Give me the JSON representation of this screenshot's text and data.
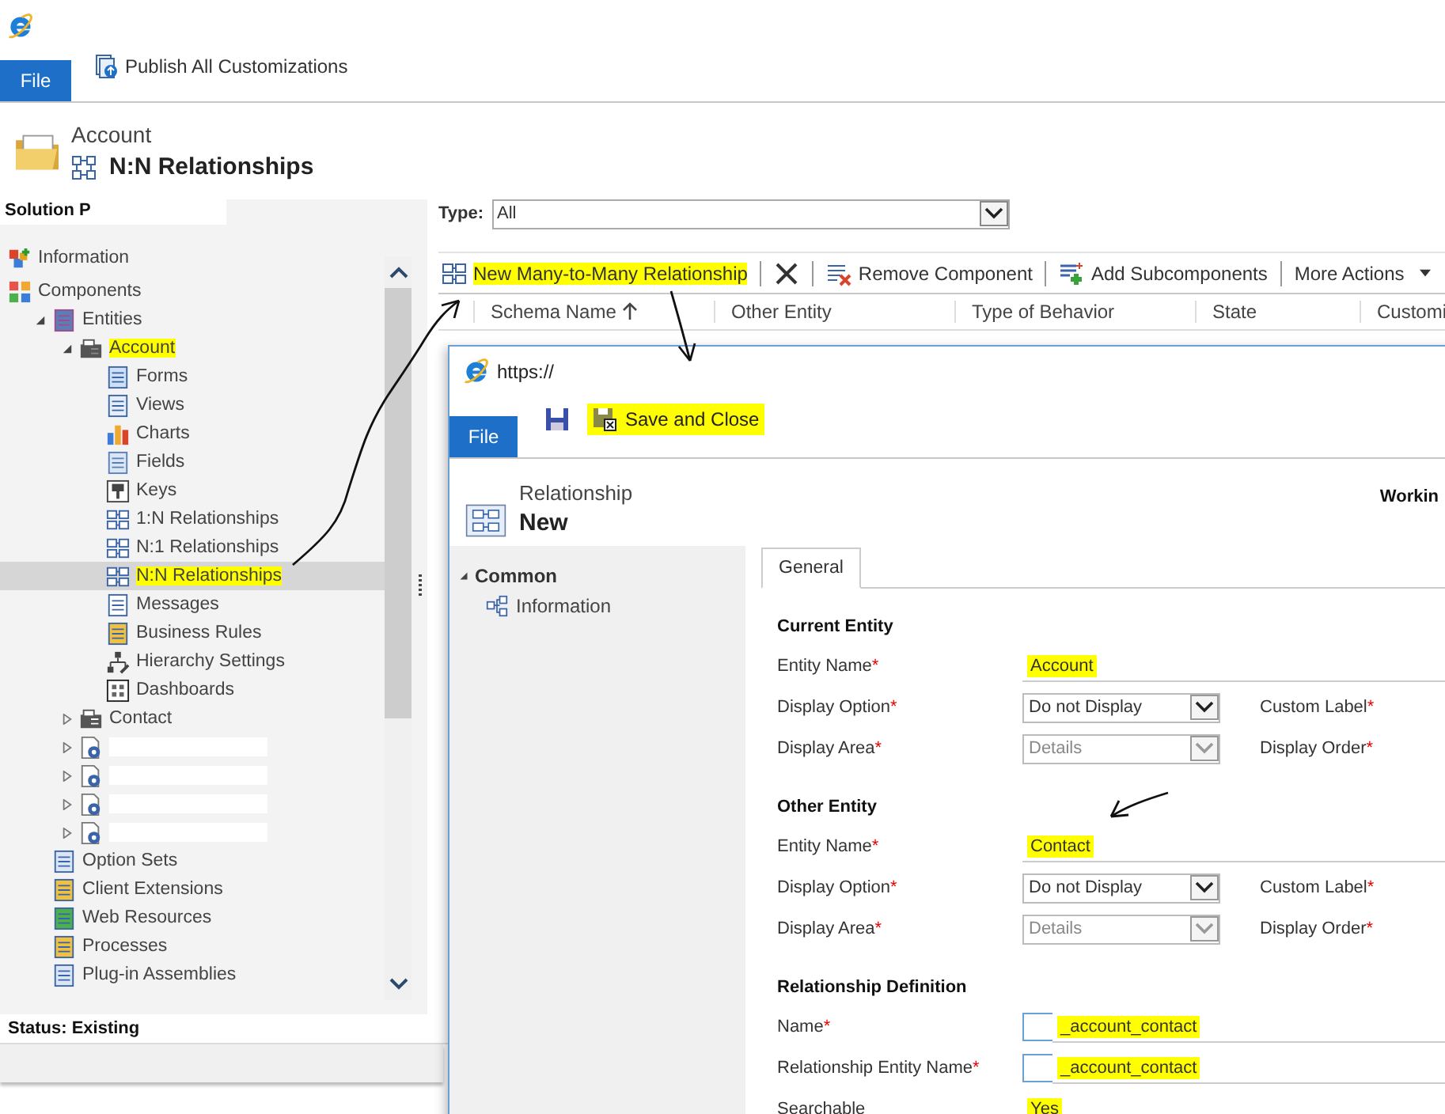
{
  "ribbon": {
    "file_tab": "File",
    "commands": [
      {
        "label": "Publish All Customizations"
      }
    ]
  },
  "header": {
    "entity": "Account",
    "title": "N:N Relationships"
  },
  "solution": {
    "title": "Solution P",
    "status": "Status: Existing",
    "tree": [
      {
        "kind": "info",
        "label": "Information",
        "selected": false,
        "highlighted": false
      },
      {
        "kind": "components",
        "label": "Components",
        "selected": false,
        "highlighted": false,
        "children": [
          {
            "kind": "entities",
            "label": "Entities",
            "selected": false,
            "highlighted": false,
            "expanded": true,
            "children": [
              {
                "kind": "entity",
                "label": "Account",
                "selected": false,
                "highlighted": true,
                "expanded": true,
                "children": [
                  {
                    "kind": "forms",
                    "label": "Forms",
                    "selected": false,
                    "highlighted": false
                  },
                  {
                    "kind": "views",
                    "label": "Views",
                    "selected": false,
                    "highlighted": false
                  },
                  {
                    "kind": "charts",
                    "label": "Charts",
                    "selected": false,
                    "highlighted": false
                  },
                  {
                    "kind": "fields",
                    "label": "Fields",
                    "selected": false,
                    "highlighted": false
                  },
                  {
                    "kind": "keys",
                    "label": "Keys",
                    "selected": false,
                    "highlighted": false
                  },
                  {
                    "kind": "relation",
                    "label": "1:N Relationships",
                    "selected": false,
                    "highlighted": false
                  },
                  {
                    "kind": "relation",
                    "label": "N:1 Relationships",
                    "selected": false,
                    "highlighted": false
                  },
                  {
                    "kind": "relation",
                    "label": "N:N Relationships",
                    "selected": true,
                    "highlighted": true
                  },
                  {
                    "kind": "messages",
                    "label": "Messages",
                    "selected": false,
                    "highlighted": false
                  },
                  {
                    "kind": "rules",
                    "label": "Business Rules",
                    "selected": false,
                    "highlighted": false
                  },
                  {
                    "kind": "hierarchy",
                    "label": "Hierarchy Settings",
                    "selected": false,
                    "highlighted": false
                  },
                  {
                    "kind": "dashboards",
                    "label": "Dashboards",
                    "selected": false,
                    "highlighted": false
                  }
                ]
              },
              {
                "kind": "contact",
                "label": "Contact",
                "selected": false,
                "highlighted": false,
                "expanded": false
              },
              {
                "kind": "custom",
                "selected": false,
                "highlighted": false,
                "expanded": false
              },
              {
                "kind": "custom",
                "selected": false,
                "highlighted": false,
                "expanded": false
              },
              {
                "kind": "custom",
                "selected": false,
                "highlighted": false,
                "expanded": false
              },
              {
                "kind": "custom",
                "selected": false,
                "highlighted": false,
                "expanded": false
              }
            ]
          },
          {
            "kind": "optionsets",
            "label": "Option Sets",
            "selected": false,
            "highlighted": false
          },
          {
            "kind": "client",
            "label": "Client Extensions",
            "selected": false,
            "highlighted": false
          },
          {
            "kind": "web",
            "label": "Web Resources",
            "selected": false,
            "highlighted": false
          },
          {
            "kind": "processes",
            "label": "Processes",
            "selected": false,
            "highlighted": false
          },
          {
            "kind": "plugin",
            "label": "Plug-in Assemblies",
            "selected": false,
            "highlighted": false
          }
        ]
      }
    ]
  },
  "filter": {
    "label": "Type:",
    "value": "All"
  },
  "toolbar": [
    {
      "kind": "relate",
      "label": "New Many-to-Many Relationship",
      "highlighted": true
    },
    {
      "kind": "delete",
      "highlighted": false
    },
    {
      "kind": "remove",
      "label": "Remove Component",
      "highlighted": false
    },
    {
      "kind": "add",
      "label": "Add Subcomponents",
      "highlighted": false
    },
    {
      "kind": "menu",
      "label": "More Actions",
      "highlighted": false
    }
  ],
  "grid": {
    "columns": [
      {
        "label": "Schema Name",
        "sorted": true
      },
      {
        "label": "Other Entity",
        "sorted": false
      },
      {
        "label": "Type of Behavior",
        "sorted": false
      },
      {
        "label": "State",
        "sorted": false
      },
      {
        "label": "Customi",
        "sorted": false
      }
    ]
  },
  "dialog": {
    "url": "https://",
    "ribbon": {
      "file_tab": "File",
      "commands": [
        {
          "kind": "save",
          "highlighted": false
        },
        {
          "kind": "saveclose",
          "label": "Save and Close",
          "highlighted": true
        }
      ]
    },
    "header": {
      "entity": "Relationship",
      "title": "New",
      "status": "Workin"
    },
    "nav": [
      {
        "label": "Common",
        "expanded": true,
        "children": [
          {
            "label": "Information",
            "selected": false
          }
        ]
      }
    ],
    "tabs": [
      {
        "label": "General",
        "selected": true
      }
    ],
    "sections": [
      {
        "title": "Current Entity",
        "fields": [
          {
            "kind": "text",
            "label": "Entity Name",
            "mark": "*",
            "value": "Account",
            "highlighted": true,
            "disabled": false
          },
          {
            "kind": "select",
            "label": "Display Option",
            "mark": "*",
            "value": "Do not Display",
            "highlighted": false,
            "disabled": false,
            "side": {
              "label": "Custom Label",
              "mark": "*"
            }
          },
          {
            "kind": "select",
            "label": "Display Area",
            "mark": "*",
            "value": "Details",
            "highlighted": false,
            "disabled": true,
            "side": {
              "label": "Display Order",
              "mark": "*"
            }
          }
        ]
      },
      {
        "title": "Other Entity",
        "fields": [
          {
            "kind": "text",
            "label": "Entity Name",
            "mark": "*",
            "value": "Contact",
            "highlighted": true,
            "disabled": false
          },
          {
            "kind": "select",
            "label": "Display Option",
            "mark": "*",
            "value": "Do not Display",
            "highlighted": false,
            "disabled": false,
            "side": {
              "label": "Custom Label",
              "mark": "*"
            }
          },
          {
            "kind": "select",
            "label": "Display Area",
            "mark": "*",
            "value": "Details",
            "highlighted": false,
            "disabled": true,
            "side": {
              "label": "Display Order",
              "mark": "*"
            }
          }
        ]
      },
      {
        "title": "Relationship Definition",
        "fields": [
          {
            "kind": "prefixed",
            "label": "Name",
            "mark": "*",
            "value": "_account_contact",
            "highlighted": true,
            "disabled": false
          },
          {
            "kind": "prefixed",
            "label": "Relationship Entity Name",
            "mark": "*",
            "value": "_account_contact",
            "highlighted": true,
            "disabled": false
          },
          {
            "kind": "text",
            "label": "Searchable",
            "value": "Yes",
            "highlighted": true,
            "disabled": false
          }
        ]
      }
    ]
  }
}
